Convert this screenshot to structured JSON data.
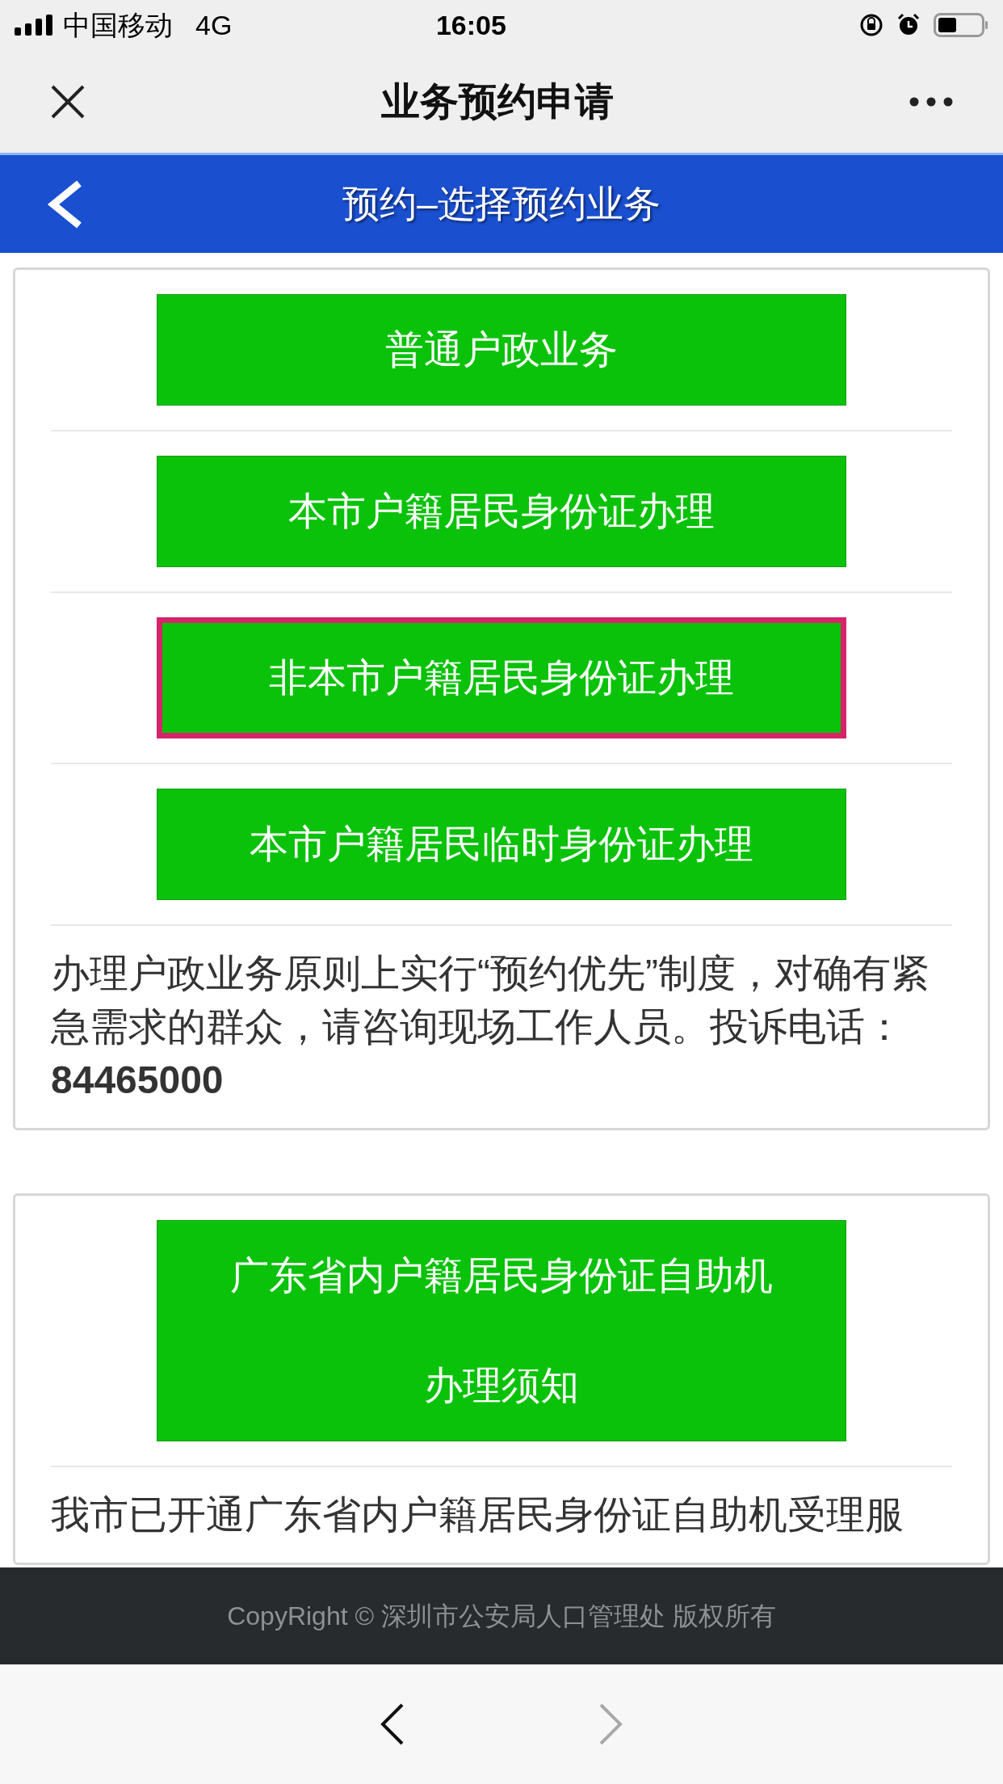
{
  "status_bar": {
    "carrier": "中国移动",
    "network": "4G",
    "time": "16:05"
  },
  "nav_bar": {
    "title": "业务预约申请"
  },
  "header": {
    "title": "预约–选择预约业务"
  },
  "cards": [
    {
      "buttons": [
        {
          "label": "普通户政业务",
          "highlighted": false
        },
        {
          "label": "本市户籍居民身份证办理",
          "highlighted": false
        },
        {
          "label": "非本市户籍居民身份证办理",
          "highlighted": true
        },
        {
          "label": "本市户籍居民临时身份证办理",
          "highlighted": false
        }
      ],
      "note": "办理户政业务原则上实行“预约优先”制度，对确有紧急需求的群众，请咨询现场工作人员。投诉电话：**84465000**"
    },
    {
      "buttons": [
        {
          "label": "广东省内户籍居民身份证自助机办理须知",
          "highlighted": false
        }
      ],
      "note": "我市已开通广东省内户籍居民身份证自助机受理服"
    }
  ],
  "footer": {
    "text": "CopyRight © 深圳市公安局人口管理处 版权所有"
  },
  "toolbar": {
    "back": {
      "disabled": false
    },
    "forward": {
      "disabled": true
    }
  }
}
